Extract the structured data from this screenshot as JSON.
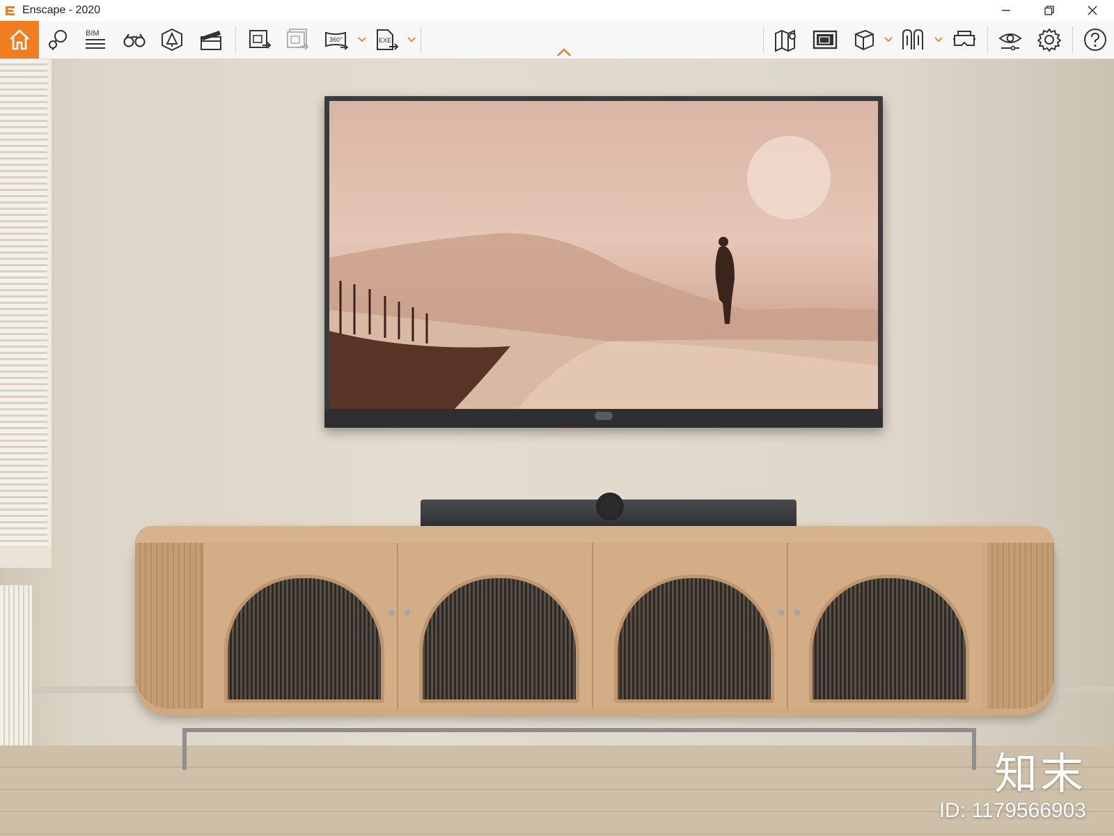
{
  "window": {
    "title": "Enscape - 2020",
    "controls": [
      "minimize",
      "restore",
      "close"
    ]
  },
  "toolbar": {
    "accent_color": "#f07d1e",
    "left_buttons": [
      {
        "name": "home",
        "icon": "home-icon",
        "active": true
      },
      {
        "name": "views",
        "icon": "map-pin-icon"
      },
      {
        "name": "bim",
        "icon": "bim-list-icon",
        "label": "BIM"
      },
      {
        "name": "explore",
        "icon": "binoculars-icon"
      },
      {
        "name": "assets",
        "icon": "asset-library-icon"
      },
      {
        "name": "video-editor",
        "icon": "clapperboard-icon"
      },
      {
        "name": "render-image",
        "icon": "export-image-icon"
      },
      {
        "name": "batch-render",
        "icon": "batch-export-icon",
        "disabled": true
      },
      {
        "name": "panorama",
        "icon": "panorama-360-icon",
        "label": "360°",
        "dropdown": true
      },
      {
        "name": "standalone-export",
        "icon": "exe-export-icon",
        "label": "EXE",
        "dropdown": true
      }
    ],
    "right_buttons": [
      {
        "name": "map",
        "icon": "map-icon"
      },
      {
        "name": "screenshot-manager",
        "icon": "gallery-icon"
      },
      {
        "name": "object-view",
        "icon": "cube-icon",
        "dropdown": true
      },
      {
        "name": "walkthrough",
        "icon": "walk-icon",
        "dropdown": true
      },
      {
        "name": "vr-headset",
        "icon": "vr-headset-icon"
      },
      {
        "name": "visual-settings",
        "icon": "eye-settings-icon"
      },
      {
        "name": "general-settings",
        "icon": "gear-icon"
      },
      {
        "name": "help",
        "icon": "help-icon"
      }
    ],
    "collapse_icon": "chevron-up-icon"
  },
  "watermark": {
    "logo_text": "知末",
    "id_text": "ID: 1179566903"
  }
}
